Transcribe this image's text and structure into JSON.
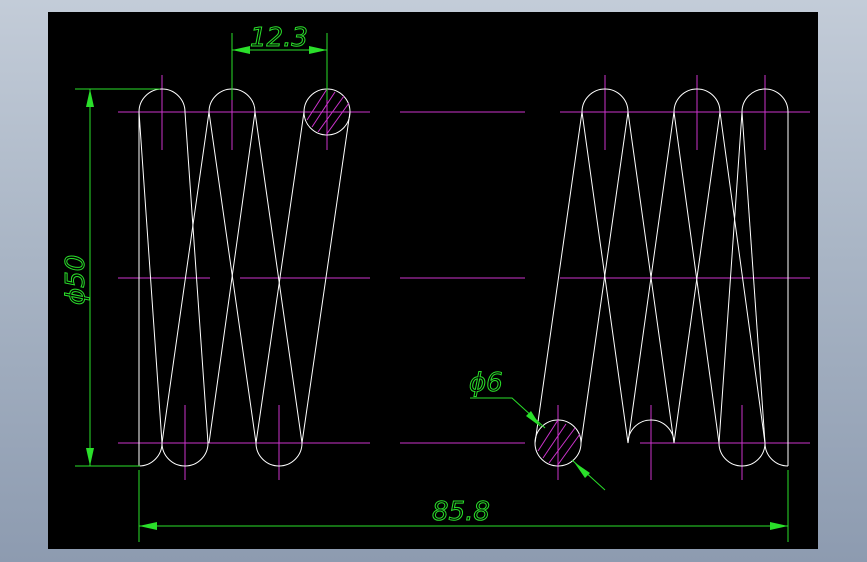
{
  "drawing": {
    "title": "",
    "colors": {
      "background": "#000000",
      "outline": "#ffffff",
      "centerline": "#cc33cc",
      "dimension": "#2adf2a",
      "frame_outer": "#a9b5c5"
    },
    "dimensions": {
      "pitch": "12.3",
      "outer_diameter": "ϕ50",
      "wire_diameter": "ϕ6",
      "overall_length": "85.8"
    }
  }
}
